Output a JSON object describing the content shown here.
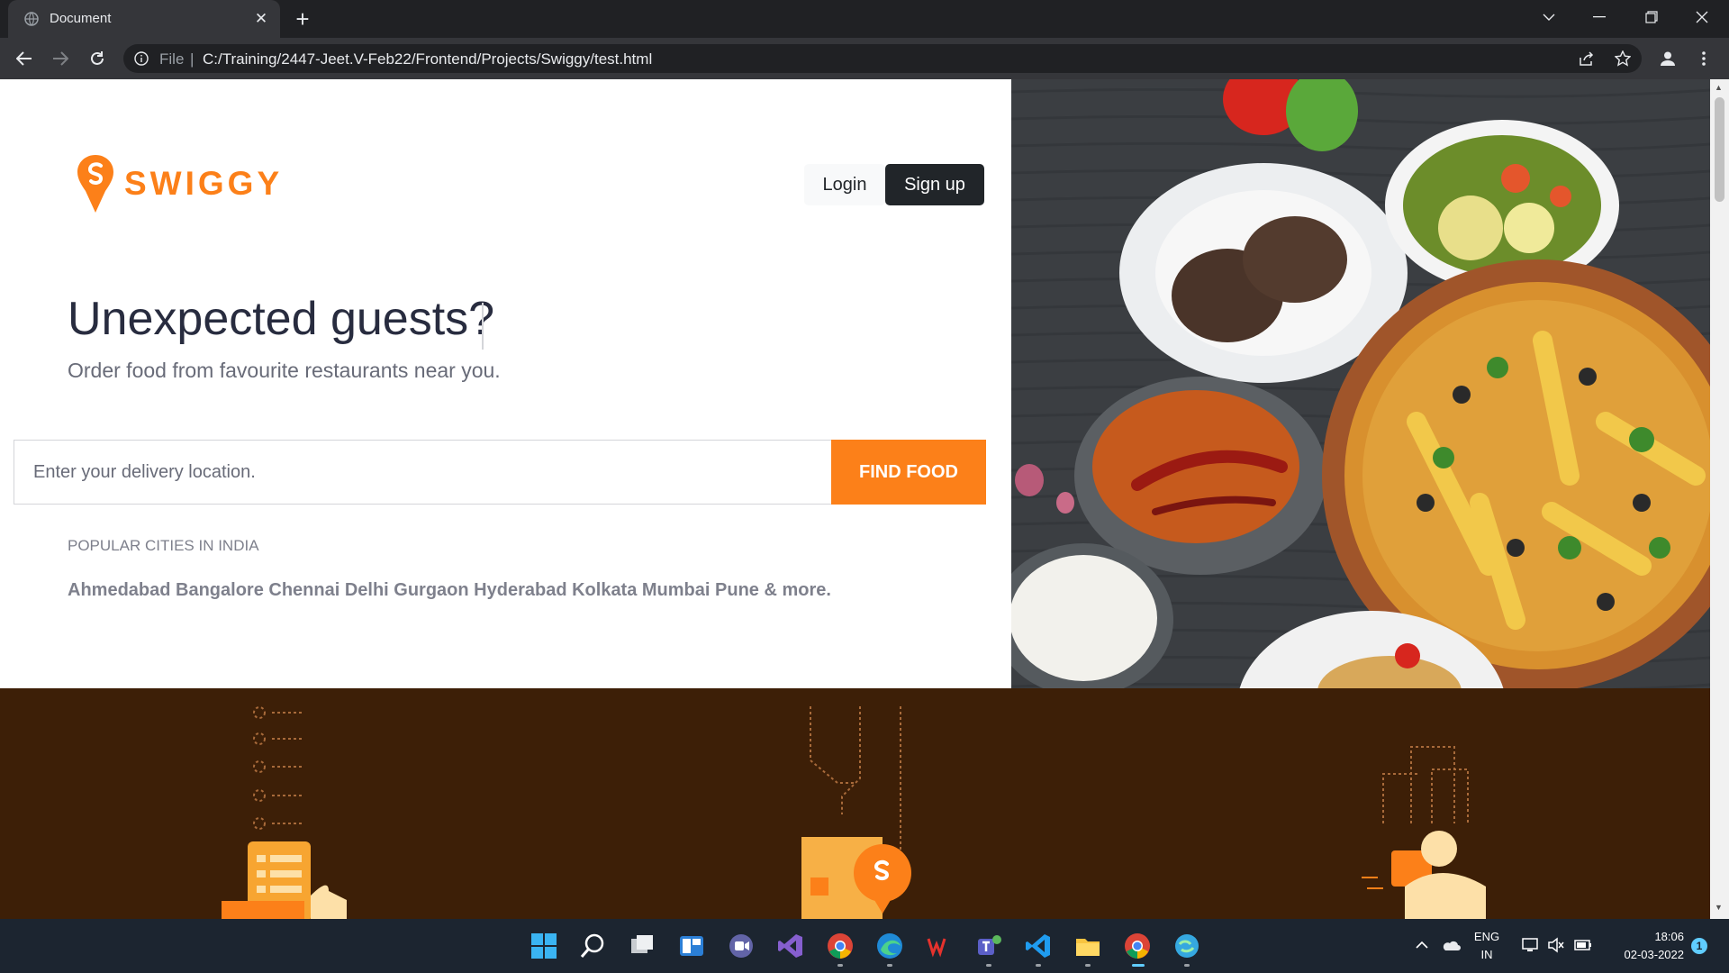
{
  "browser": {
    "tab_title": "Document",
    "close_glyph": "✕",
    "new_tab_glyph": "+",
    "address_scheme": "File",
    "address_separator": "|",
    "url": "C:/Training/2447-Jeet.V-Feb22/Frontend/Projects/Swiggy/test.html"
  },
  "page": {
    "brand": "SWIGGY",
    "login_label": "Login",
    "signup_label": "Sign up",
    "headline": "Unexpected guests?",
    "subline": "Order food from favourite restaurants near you.",
    "search_placeholder": "Enter your delivery location.",
    "find_food_label": "FIND FOOD",
    "cities_label": "POPULAR CITIES IN INDIA",
    "cities": "Ahmedabad Bangalore Chennai Delhi Gurgaon Hyderabad Kolkata Mumbai Pune & more."
  },
  "taskbar": {
    "lang_line1": "ENG",
    "lang_line2": "IN",
    "time": "18:06",
    "date": "02-03-2022",
    "notification_count": "1"
  },
  "colors": {
    "accent": "#fc8019",
    "dark_button": "#212529",
    "how_section_bg": "#3d1f07"
  }
}
